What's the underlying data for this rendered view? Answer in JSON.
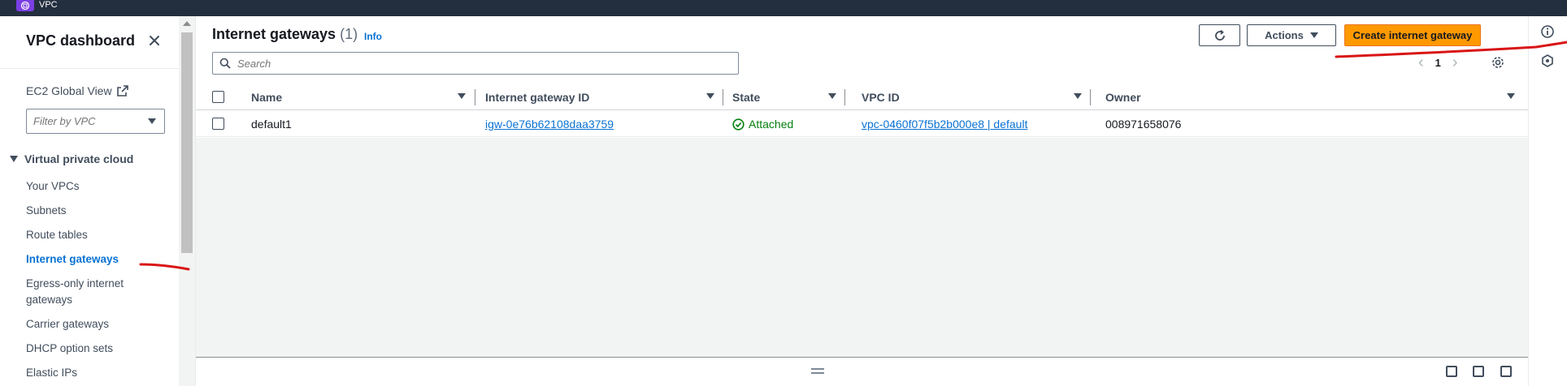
{
  "topbar": {
    "service_name": "VPC",
    "service_icon": "vpc-icon",
    "accent": "#7b3fe4"
  },
  "sidebar": {
    "title": "VPC dashboard",
    "close_icon": "close-icon",
    "ec2_link": "EC2 Global View",
    "filter_placeholder": "Filter by VPC",
    "section_label": "Virtual private cloud",
    "items": [
      {
        "label": "Your VPCs",
        "active": false
      },
      {
        "label": "Subnets",
        "active": false
      },
      {
        "label": "Route tables",
        "active": false
      },
      {
        "label": "Internet gateways",
        "active": true
      },
      {
        "label": "Egress-only internet gateways",
        "active": false
      },
      {
        "label": "Carrier gateways",
        "active": false
      },
      {
        "label": "DHCP option sets",
        "active": false
      },
      {
        "label": "Elastic IPs",
        "active": false
      }
    ]
  },
  "panel": {
    "title": "Internet gateways",
    "count": "(1)",
    "info_label": "Info",
    "actions_label": "Actions",
    "create_label": "Create internet gateway",
    "search_placeholder": "Search",
    "current_page": "1"
  },
  "table": {
    "columns": [
      "Name",
      "Internet gateway ID",
      "State",
      "VPC ID",
      "Owner"
    ],
    "rows": [
      {
        "name": "default1",
        "igw_id": "igw-0e76b62108daa3759",
        "state": "Attached",
        "vpc_id": "vpc-0460f07f5b2b000e8 | default",
        "owner": "008971658076"
      }
    ]
  },
  "colors": {
    "primary_button": "#ff9900",
    "link": "#0972d3",
    "success": "#037f0c",
    "annotation": "#d91515"
  }
}
